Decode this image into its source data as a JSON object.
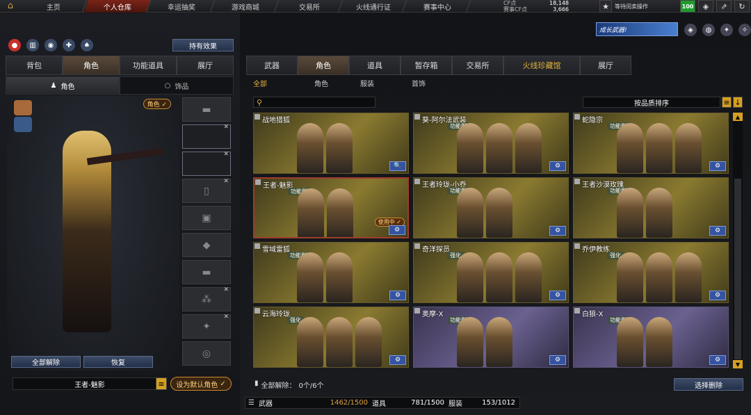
{
  "topnav": {
    "tabs": [
      "主页",
      "个人仓库",
      "幸运抽奖",
      "游戏商城",
      "交易所",
      "火线通行证",
      "赛事中心"
    ],
    "cf_label": "CF点",
    "cf_value": "18,148",
    "match_cf_label": "赛事CF点",
    "match_cf_value": "3,666",
    "status_text": "等待闰卖操作",
    "level": "100"
  },
  "left": {
    "effects_button": "持有效果",
    "tabs": [
      "背包",
      "角色",
      "功能道具",
      "展厅"
    ],
    "subtabs": [
      "角色",
      "饰品"
    ],
    "role_badge": "角色",
    "unequip_all": "全部解除",
    "restore": "恢复",
    "character_name": "王者-魅影",
    "set_default": "设为默认角色"
  },
  "right": {
    "banner": "成长武器!",
    "tabs": [
      "武器",
      "角色",
      "道具",
      "暂存箱",
      "交易所",
      "火线珍藏馆",
      "展厅"
    ],
    "subtabs": [
      "全部",
      "角色",
      "服装",
      "首饰"
    ],
    "sort_label": "按品质排序",
    "cards": [
      {
        "title": "战地猎狐",
        "badge": ""
      },
      {
        "title": "葵-阿尔法武装",
        "badge": "功能型"
      },
      {
        "title": "蛇隐宗",
        "badge": "功能型"
      },
      {
        "title": "王者-魅影",
        "badge": "功能型",
        "inuse": "使用中"
      },
      {
        "title": "王者玲珑-小乔",
        "badge": "功能型"
      },
      {
        "title": "王者沙漠玫瑰",
        "badge": "功能型"
      },
      {
        "title": "雪域雷狐",
        "badge": "功能型"
      },
      {
        "title": "奇洋探员",
        "badge": "强化"
      },
      {
        "title": "乔伊教练",
        "badge": "强化"
      },
      {
        "title": "云海玲珑",
        "badge": "强化"
      },
      {
        "title": "奥摩-X",
        "badge": "功能型"
      },
      {
        "title": "白狼-X",
        "badge": "功能型"
      }
    ],
    "unequip_count_label": "全部解除：",
    "unequip_count": "0个/6个",
    "select_delete": "选择删除",
    "footer": [
      {
        "label": "武器",
        "value": "1462/1500"
      },
      {
        "label": "道具",
        "value": "781/1500"
      },
      {
        "label": "服装",
        "value": "153/1012"
      }
    ]
  }
}
